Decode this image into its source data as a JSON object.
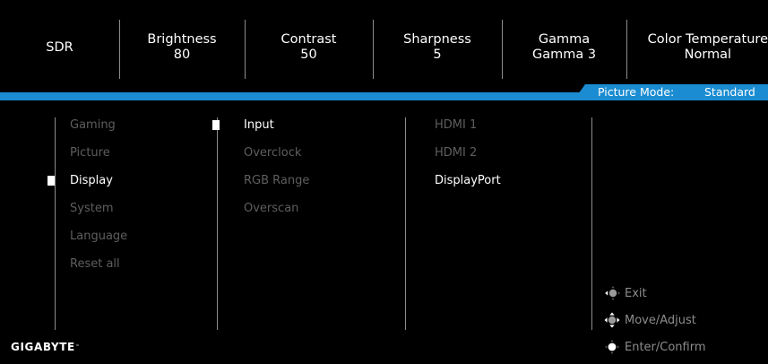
{
  "status_bar": [
    {
      "label": "SDR",
      "value": ""
    },
    {
      "label": "Brightness",
      "value": "80"
    },
    {
      "label": "Contrast",
      "value": "50"
    },
    {
      "label": "Sharpness",
      "value": "5"
    },
    {
      "label": "Gamma",
      "value": "Gamma 3"
    },
    {
      "label": "Color Temperature",
      "value": "Normal"
    }
  ],
  "picture_mode": {
    "label": "Picture Mode:",
    "value": "Standard"
  },
  "main_menu": {
    "items": [
      "Gaming",
      "Picture",
      "Display",
      "System",
      "Language",
      "Reset all"
    ],
    "selected": "Display"
  },
  "display_menu": {
    "items": [
      "Input",
      "Overclock",
      "RGB Range",
      "Overscan"
    ],
    "selected": "Input"
  },
  "input_menu": {
    "items": [
      "HDMI 1",
      "HDMI 2",
      "DisplayPort"
    ],
    "selected": "DisplayPort"
  },
  "help": [
    {
      "icon": "joystick-left-icon",
      "label": "Exit"
    },
    {
      "icon": "joystick-all-directions-icon",
      "label": "Move/Adjust"
    },
    {
      "icon": "joystick-press-icon",
      "label": "Enter/Confirm"
    }
  ],
  "brand": "GIGABYTE",
  "colors": {
    "accent": "#1b8cd1",
    "active_text": "#ffffff",
    "inactive_text": "#5e5e5e"
  }
}
